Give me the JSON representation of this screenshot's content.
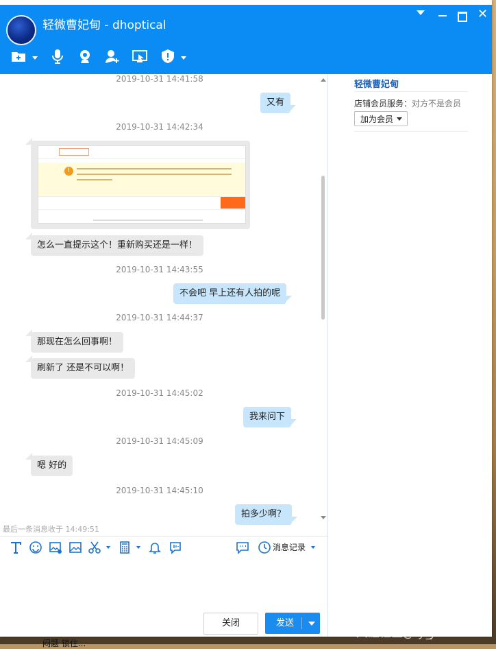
{
  "window": {
    "title": "轻微曹妃甸 - dhoptical",
    "accent_color": "#0b8cf4"
  },
  "toolbar": {
    "icons": [
      "file-transfer-icon",
      "microphone-icon",
      "video-icon",
      "add-contact-icon",
      "remote-assist-icon",
      "shield-icon"
    ]
  },
  "chat": {
    "timestamps": [
      "2019-10-31 14:41:58",
      "2019-10-31 14:42:34",
      "2019-10-31 14:43:55",
      "2019-10-31 14:44:37",
      "2019-10-31 14:45:02",
      "2019-10-31 14:45:09",
      "2019-10-31 14:45:10"
    ],
    "messages": [
      {
        "from": "me",
        "text": "又有"
      },
      {
        "from": "them",
        "text": "怎么一直提示这个！重新购买还是一样！"
      },
      {
        "from": "me",
        "text": "不会吧    早上还有人拍的呢"
      },
      {
        "from": "them",
        "text": "那现在怎么回事啊！"
      },
      {
        "from": "them",
        "text": "刷新了 还是不可以啊！"
      },
      {
        "from": "me",
        "text": "我来问下"
      },
      {
        "from": "them",
        "text": "嗯 好的"
      },
      {
        "from": "me",
        "text": "拍多少啊？"
      }
    ],
    "last_message_note": "最后一条消息收于 14:49:51"
  },
  "input_toolbar": {
    "history_label": "消息记录"
  },
  "buttons": {
    "close": "关闭",
    "send": "发送"
  },
  "sidebar": {
    "shop_name": "轻微曹妃甸",
    "service_label": "店铺会员服务：",
    "service_value": "对方不是会员",
    "join_label": "加为会员"
  },
  "watermark": "天涯社区@ty_JIMMY60",
  "background_text": "闷题 锁住..."
}
